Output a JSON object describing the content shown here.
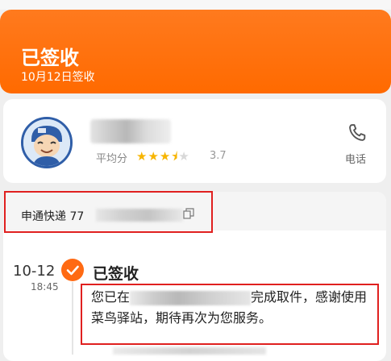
{
  "status": {
    "title": "已签收",
    "date": "10月12日签收"
  },
  "courier": {
    "rating_label": "平均分",
    "rating_value": 3.5,
    "rating_score": "3.7",
    "phone_label": "电话"
  },
  "express": {
    "label": "申通快递 77"
  },
  "timeline": {
    "date": "10-12",
    "time": "18:45",
    "event_title": "已签收",
    "event_desc_prefix": "您已在",
    "event_desc_suffix": "完成取件，感谢使用菜鸟驿站，期待再次为您服务。"
  },
  "colors": {
    "accent": "#ff6a00",
    "highlight_box": "#e0201f"
  },
  "icons": {
    "check": "check-icon",
    "phone": "phone-icon",
    "copy": "copy-icon",
    "avatar": "courier-avatar"
  }
}
